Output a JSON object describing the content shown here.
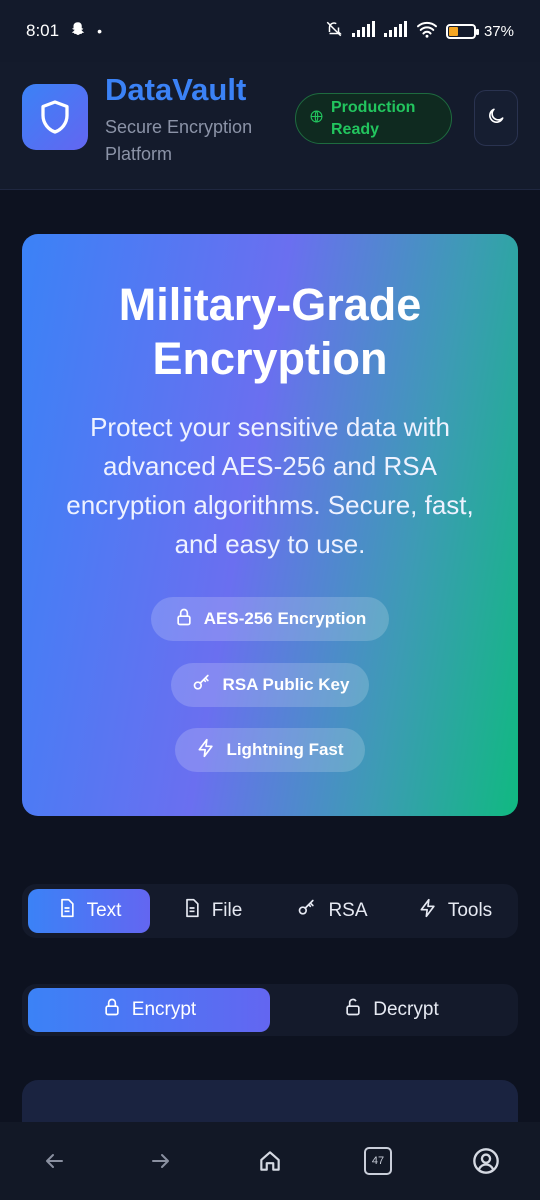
{
  "status_bar": {
    "time": "8:01",
    "battery_percent": "37%",
    "battery_level": 0.37,
    "icons": [
      "snapchat-icon",
      "dot-icon",
      "mute-icon",
      "signal-icon",
      "signal-icon",
      "wifi-icon",
      "battery-icon"
    ]
  },
  "header": {
    "brand_name": "DataVault",
    "brand_subtitle": "Secure Encryption Platform",
    "badge_label": "Production Ready",
    "logo_icon": "shield-icon",
    "theme_icon": "moon-icon"
  },
  "hero": {
    "title": "Military-Grade Encryption",
    "description": "Protect your sensitive data with advanced AES-256 and RSA encryption algorithms. Secure, fast, and easy to use.",
    "features": [
      {
        "label": "AES-256 Encryption",
        "icon": "lock-icon"
      },
      {
        "label": "RSA Public Key",
        "icon": "key-icon"
      },
      {
        "label": "Lightning Fast",
        "icon": "lightning-icon"
      }
    ]
  },
  "tabs": [
    {
      "label": "Text",
      "icon": "document-icon",
      "active": true
    },
    {
      "label": "File",
      "icon": "file-icon",
      "active": false
    },
    {
      "label": "RSA",
      "icon": "key-icon",
      "active": false
    },
    {
      "label": "Tools",
      "icon": "lightning-icon",
      "active": false
    }
  ],
  "mode": {
    "encrypt_label": "Encrypt",
    "decrypt_label": "Decrypt",
    "active": "encrypt"
  },
  "colors": {
    "accent": "#3b82f6",
    "accent_secondary": "#6366f1",
    "success": "#22c55e",
    "background": "#0d1220"
  },
  "nav_bar": {
    "tab_count": "47",
    "icons": [
      "back-arrow-icon",
      "forward-arrow-icon",
      "home-icon",
      "tabs-icon",
      "account-icon"
    ]
  }
}
